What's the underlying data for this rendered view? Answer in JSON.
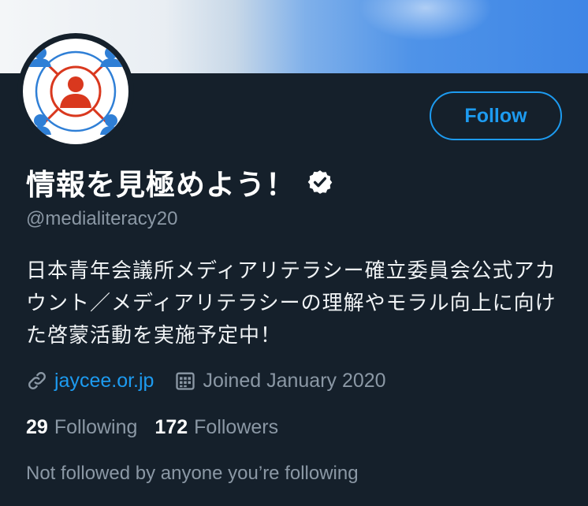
{
  "profile": {
    "display_name": "情報を見極めよう！",
    "handle": "@medialiteracy20",
    "bio": "日本青年会議所メディアリテラシー確立委員会公式アカウント／メディアリテラシーの理解やモラル向上に向けた啓蒙活動を実施予定中！",
    "website": "jaycee.or.jp",
    "joined": "Joined January 2020",
    "following_count": "29",
    "following_label": "Following",
    "followers_count": "172",
    "followers_label": "Followers",
    "not_followed_text": "Not followed by anyone you’re following"
  },
  "actions": {
    "follow_label": "Follow"
  },
  "icons": {
    "verified": "verified-badge-icon",
    "link": "link-icon",
    "calendar": "calendar-icon"
  },
  "colors": {
    "background": "#15202b",
    "accent": "#1d9bf0",
    "muted": "#8b98a5",
    "avatar_center": "#d9381e",
    "avatar_people": "#2f7fd6"
  }
}
